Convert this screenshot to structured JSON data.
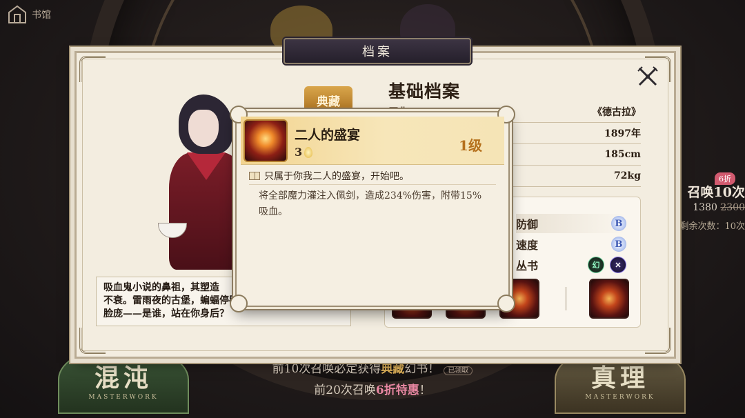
{
  "top_nav": {
    "label": "书馆",
    "home_icon": "castle-home-icon"
  },
  "panel": {
    "header_title": "档案",
    "close_icon": "crossed-swords-close-icon",
    "seal_label": "典藏",
    "character_description": "吸血鬼小说的鼻祖，其塑造\n不衰。雷雨夜的古堡，蝙蝠停歇的\n脸庞——是谁，站在你身后？"
  },
  "profile": {
    "title": "基础档案",
    "rows": [
      {
        "key": "原典",
        "value": "《德古拉》"
      },
      {
        "key": "",
        "value": "1897年"
      },
      {
        "key": "",
        "value": "185cm"
      },
      {
        "key": "",
        "value": "72kg"
      }
    ]
  },
  "stats": {
    "defense_label": "防御",
    "defense_grade": "B",
    "speed_label": "速度",
    "speed_grade": "B",
    "series_label": "丛书",
    "series_icons": [
      "幻",
      "✕"
    ]
  },
  "tooltip": {
    "skill_name": "二人的盛宴",
    "cost": "3",
    "level": "1级",
    "quote": "只属于你我二人的盛宴，开始吧。",
    "description": "将全部魔力灌注入佩剑，造成234%伤害，附带15%吸血。"
  },
  "side_summon": {
    "badge": "6折",
    "title": "召唤10次",
    "price": "1380",
    "old_price": "2300",
    "remaining": "剩余次数：10次"
  },
  "pools": {
    "left_name": "混沌",
    "right_name": "真理",
    "subtitle": "MASTERWORK"
  },
  "bottom": {
    "line1_prefix": "前10次召唤必定获得",
    "line1_highlight": "典藏",
    "line1_suffix": "幻书！",
    "claimed_badge": "已领取",
    "line2_prefix": "前20次召唤",
    "line2_highlight": "6折特惠",
    "line2_suffix": "！"
  }
}
